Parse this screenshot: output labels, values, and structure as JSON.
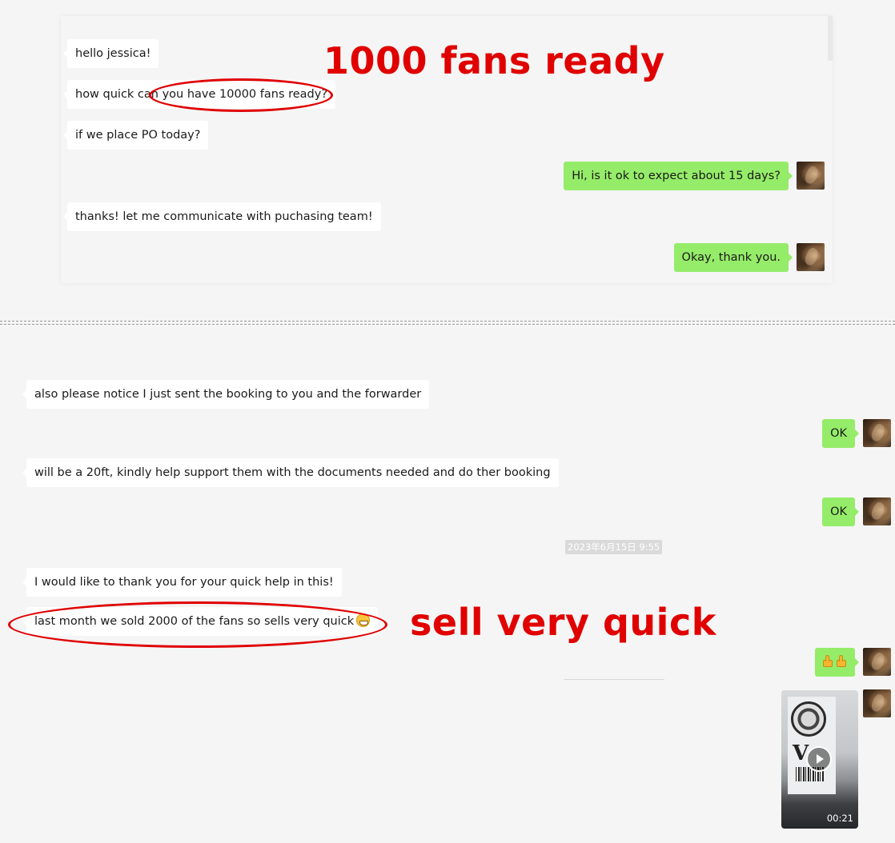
{
  "top_chat": {
    "messages": [
      {
        "text": "hello jessica!",
        "dir": "in"
      },
      {
        "text": "how quick can you have 10000 fans ready?",
        "dir": "in"
      },
      {
        "text": "if we place PO today?",
        "dir": "in"
      },
      {
        "text": "Hi, is it ok to expect about 15 days?",
        "dir": "out"
      },
      {
        "text": "thanks! let me communicate with puchasing team!",
        "dir": "in"
      },
      {
        "text": "Okay, thank you.",
        "dir": "out"
      }
    ]
  },
  "bottom_chat": {
    "messages": [
      {
        "text": "also please notice I just sent the booking to you and the forwarder",
        "dir": "in"
      },
      {
        "text": "OK",
        "dir": "out"
      },
      {
        "text": "will be a 20ft, kindly help support them with the documents needed and do ther booking",
        "dir": "in"
      },
      {
        "text": "OK",
        "dir": "out"
      },
      {
        "text": "I would like to thank you for your quick help in this!",
        "dir": "in"
      },
      {
        "text": "last month we sold 2000 of the fans so sells very quick",
        "dir": "in",
        "emoji": "grinning-face"
      },
      {
        "text": "",
        "dir": "out",
        "emoji": "thumbs-up x2"
      }
    ],
    "timestamp": "2023年6月15日 9:55",
    "video": {
      "duration": "00:21"
    }
  },
  "annotations": {
    "top_note": "1000 fans ready",
    "bottom_note": "sell very quick",
    "color": "#e00000"
  },
  "colors": {
    "outgoing_bubble": "#95ec69",
    "incoming_bubble": "#ffffff",
    "background": "#f5f5f5"
  }
}
